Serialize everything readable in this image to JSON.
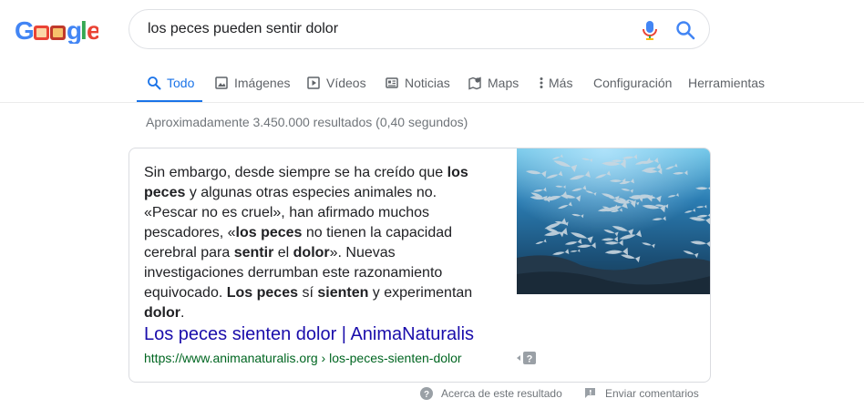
{
  "search": {
    "query": "los peces pueden sentir dolor",
    "logo_label": "Google"
  },
  "tabs": [
    {
      "label": "Todo",
      "icon": "search-icon",
      "active": true
    },
    {
      "label": "Imágenes",
      "icon": "image-icon"
    },
    {
      "label": "Vídeos",
      "icon": "play-icon"
    },
    {
      "label": "Noticias",
      "icon": "news-icon"
    },
    {
      "label": "Maps",
      "icon": "map-pin-icon"
    },
    {
      "label": "Más",
      "icon": "more-vert-icon"
    },
    {
      "label": "Configuración"
    },
    {
      "label": "Herramientas"
    }
  ],
  "results": {
    "stats": "Aproximadamente 3.450.000 resultados (0,40 segundos)"
  },
  "featured_snippet": {
    "segments": [
      {
        "t": "Sin embargo, desde siempre se ha creído que "
      },
      {
        "t": "los peces",
        "b": true
      },
      {
        "t": " y algunas otras especies animales no. «Pescar no es cruel», han afirmado muchos pescadores, «"
      },
      {
        "t": "los peces",
        "b": true
      },
      {
        "t": " no tienen la capacidad cerebral para "
      },
      {
        "t": "sentir",
        "b": true
      },
      {
        "t": " el "
      },
      {
        "t": "dolor",
        "b": true
      },
      {
        "t": "». Nuevas investigaciones derrumban este razonamiento equivocado. "
      },
      {
        "t": "Los peces",
        "b": true
      },
      {
        "t": " sí "
      },
      {
        "t": "sienten",
        "b": true
      },
      {
        "t": " y experimentan "
      },
      {
        "t": "dolor",
        "b": true
      },
      {
        "t": "."
      }
    ],
    "title": "Los peces sienten dolor | AnimaNaturalis",
    "url": "https://www.animanaturalis.org › los-peces-sienten-dolor"
  },
  "footer": {
    "about": "Acerca de este resultado",
    "feedback": "Enviar comentarios"
  },
  "colors": {
    "accent": "#1a73e8",
    "link": "#1a0dab",
    "url_green": "#006621",
    "meta_gray": "#70757a"
  }
}
